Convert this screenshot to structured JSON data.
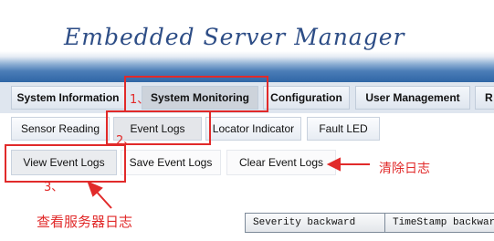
{
  "banner": {
    "title": "Embedded Server Manager"
  },
  "nav_primary": [
    "System Information",
    "System Monitoring",
    "Configuration",
    "User Management",
    "R"
  ],
  "nav_secondary": [
    "Sensor Reading",
    "Event Logs",
    "Locator Indicator",
    "Fault LED"
  ],
  "nav_actions": [
    "View Event Logs",
    "Save Event Logs",
    "Clear Event Logs"
  ],
  "annotations": {
    "step1": "1、",
    "step2": "2、",
    "step3": "3、",
    "clear_logs_note": "清除日志",
    "view_logs_note": "查看服务器日志"
  },
  "log_table": {
    "columns": [
      "Severity  backward",
      "TimeStamp  backward"
    ]
  },
  "colors": {
    "annotation": "#e12a2a",
    "banner_blue": "#2f66a6"
  }
}
